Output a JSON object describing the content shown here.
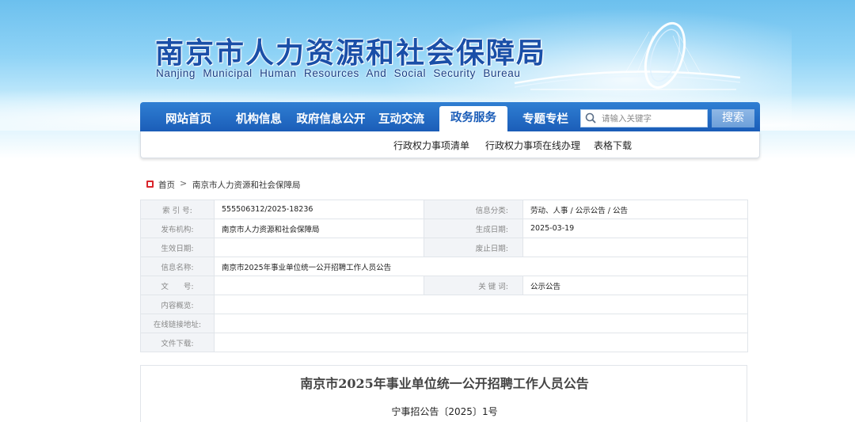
{
  "header": {
    "title": "南京市人力资源和社会保障局",
    "subtitle": "Nanjing Municipal Human Resources And Social Security Bureau"
  },
  "nav": {
    "items": [
      "网站首页",
      "机构信息",
      "政府信息公开",
      "互动交流",
      "政务服务",
      "专题专栏"
    ],
    "active": "政务服务",
    "search_placeholder": "请输入关键字",
    "search_button": "搜索"
  },
  "subnav": {
    "items": [
      "行政权力事项清单",
      "行政权力事项在线办理",
      "表格下载"
    ]
  },
  "breadcrumb": {
    "home": "首页",
    "separator": ">",
    "current": "南京市人力资源和社会保障局"
  },
  "info_table": {
    "index_label": "索 引 号:",
    "index_value": "555506312/2025-18236",
    "category_label": "信息分类:",
    "category_value": "劳动、人事 / 公示公告 / 公告",
    "publisher_label": "发布机构:",
    "publisher_value": "南京市人力资源和社会保障局",
    "created_label": "生成日期:",
    "created_value": "2025-03-19",
    "effective_label": "生效日期:",
    "effective_value": "",
    "expiry_label": "废止日期:",
    "expiry_value": "",
    "name_label": "信息名称:",
    "name_value": "南京市2025年事业单位统一公开招聘工作人员公告",
    "docno_label": "文　　号:",
    "docno_value": "",
    "keywords_label": "关 键 词:",
    "keywords_value": "公示公告",
    "summary_label": "内容概览:",
    "summary_value": "",
    "link_label": "在线链接地址:",
    "link_value": "",
    "download_label": "文件下载:",
    "download_value": ""
  },
  "article": {
    "title": "南京市2025年事业单位统一公开招聘工作人员公告",
    "doc_number": "宁事招公告〔2025〕1号"
  },
  "colors": {
    "nav_blue": "#1b5db8",
    "title_blue": "#1a4fa8",
    "home_icon_red": "#d9262c"
  }
}
